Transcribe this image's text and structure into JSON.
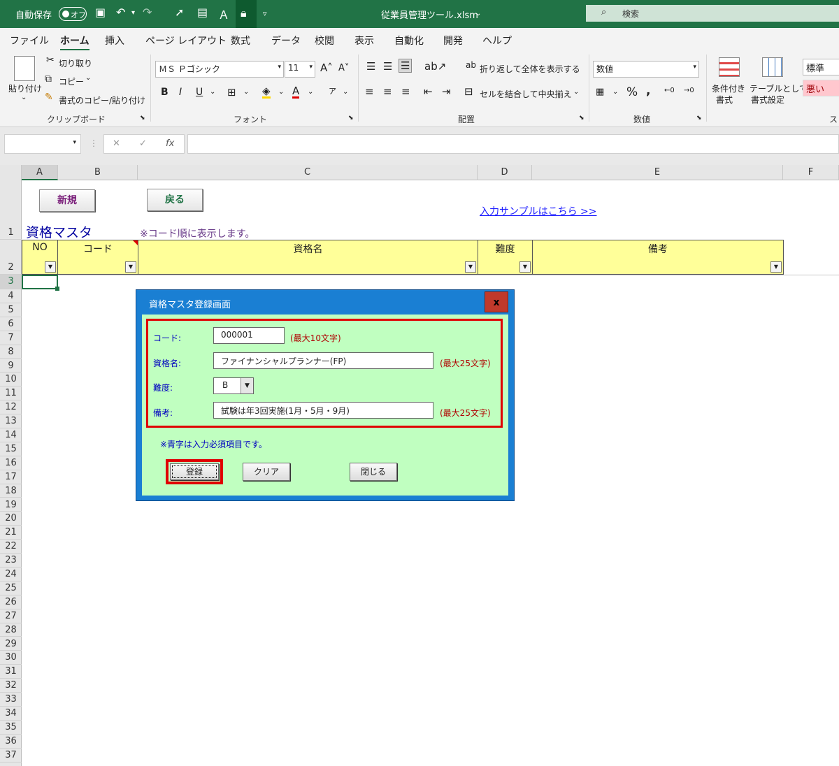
{
  "titlebar": {
    "autosave_label": "自動保存",
    "autosave_state": "オフ",
    "filename": "従業員管理ツール.xlsm",
    "search_placeholder": "検索"
  },
  "tabs": [
    "ファイル",
    "ホーム",
    "挿入",
    "ページ レイアウト",
    "数式",
    "データ",
    "校閲",
    "表示",
    "自動化",
    "開発",
    "ヘルプ"
  ],
  "ribbon": {
    "clipboard": {
      "paste": "貼り付け",
      "cut": "切り取り",
      "copy": "コピー",
      "format_painter": "書式のコピー/貼り付け",
      "group": "クリップボード"
    },
    "font": {
      "name": "ＭＳ Ｐゴシック",
      "size": "11",
      "group": "フォント"
    },
    "alignment": {
      "wrap": "折り返して全体を表示する",
      "merge": "セルを結合して中央揃え",
      "group": "配置"
    },
    "number": {
      "format": "数値",
      "group": "数値"
    },
    "styles": {
      "conditional": "条件付き",
      "conditional2": "書式",
      "table": "テーブルとして",
      "table2": "書式設定",
      "normal": "標準",
      "bad": "悪い",
      "group_short": "ス"
    }
  },
  "columns": [
    "A",
    "B",
    "C",
    "D",
    "E",
    "F"
  ],
  "rows": [
    "1",
    "2",
    "3",
    "4",
    "5",
    "6",
    "7",
    "8",
    "9",
    "10",
    "11",
    "12",
    "13",
    "14",
    "15",
    "16",
    "17",
    "18",
    "19",
    "20",
    "21",
    "22",
    "23",
    "24",
    "25",
    "26",
    "27",
    "28",
    "29",
    "30",
    "31",
    "32",
    "33",
    "34",
    "35",
    "36",
    "37"
  ],
  "sheet": {
    "btn_new": "新規",
    "btn_back": "戻る",
    "sample_link": "入力サンプルはこちら >>",
    "title": "資格マスタ",
    "note": "※コード順に表示します。",
    "headers": [
      "NO",
      "コード",
      "資格名",
      "難度",
      "備考"
    ]
  },
  "dialog": {
    "title": "資格マスタ登録画面",
    "close": "x",
    "code_label": "コード:",
    "code_value": "000001",
    "code_limit": "(最大10文字)",
    "name_label": "資格名:",
    "name_value": "ファイナンシャルプランナー(FP)",
    "name_limit": "(最大25文字)",
    "level_label": "難度:",
    "level_value": "B",
    "remark_label": "備考:",
    "remark_value": "試験は年3回実施(1月・5月・9月)",
    "remark_limit": "(最大25文字)",
    "required_note": "※青字は入力必須項目です。",
    "register": "登録",
    "clear": "クリア",
    "close_btn": "閉じる"
  }
}
